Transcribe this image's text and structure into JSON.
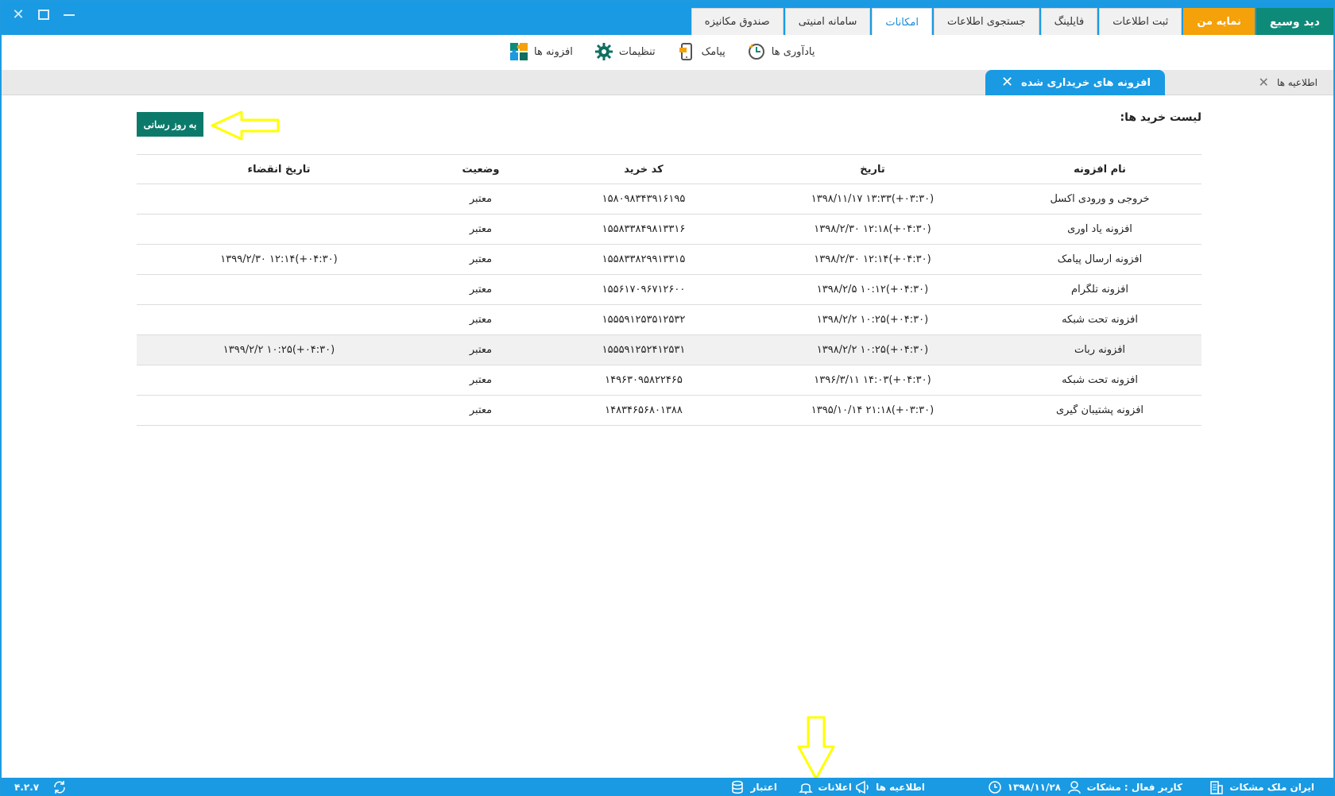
{
  "top_tabs": [
    {
      "label": "دید وسیع",
      "style": "teal"
    },
    {
      "label": "نمایه من",
      "style": "orange"
    },
    {
      "label": "ثبت اطلاعات",
      "style": "normal"
    },
    {
      "label": "فایلینگ",
      "style": "normal"
    },
    {
      "label": "جستجوی اطلاعات",
      "style": "normal"
    },
    {
      "label": "امکانات",
      "style": "active"
    },
    {
      "label": "سامانه امنیتی",
      "style": "normal"
    },
    {
      "label": "صندوق مکانیزه",
      "style": "normal"
    }
  ],
  "ribbon": {
    "reminders": "یادآوری ها",
    "sms": "پیامک",
    "settings": "تنظیمات",
    "addons": "افزونه ها"
  },
  "doc_tabs": {
    "notices": "اطلاعیه ها",
    "purchased": "افزونه های خریداری شده"
  },
  "content": {
    "list_title": "لیست خرید ها:",
    "refresh_label": "به روز رسانی"
  },
  "table": {
    "headers": {
      "name": "نام افزونه",
      "date": "تاریخ",
      "code": "کد خرید",
      "status": "وضعیت",
      "expiry": "تاریخ انقضاء"
    },
    "rows": [
      {
        "name": "خروجی و ورودی اکسل",
        "date": "۱۳۹۸/۱۱/۱۷ ۱۳:۳۳(+۰۳:۳۰)",
        "code": "۱۵۸۰۹۸۳۴۳۹۱۶۱۹۵",
        "status": "معتبر",
        "expiry": ""
      },
      {
        "name": "افزونه یاد آوری",
        "date": "۱۳۹۸/۲/۳۰ ۱۲:۱۸(+۰۴:۳۰)",
        "code": "۱۵۵۸۳۳۸۴۹۸۱۳۳۱۶",
        "status": "معتبر",
        "expiry": ""
      },
      {
        "name": "افزونه ارسال پیامک",
        "date": "۱۳۹۸/۲/۳۰ ۱۲:۱۴(+۰۴:۳۰)",
        "code": "۱۵۵۸۳۳۸۲۹۹۱۳۳۱۵",
        "status": "معتبر",
        "expiry": "۱۳۹۹/۲/۳۰ ۱۲:۱۴(+۰۴:۳۰)"
      },
      {
        "name": "افزونه تلگرام",
        "date": "۱۳۹۸/۲/۵ ۱۰:۱۲(+۰۴:۳۰)",
        "code": "۱۵۵۶۱۷۰۹۶۷۱۲۶۰۰",
        "status": "معتبر",
        "expiry": ""
      },
      {
        "name": "افزونه تحت شبکه",
        "date": "۱۳۹۸/۲/۲ ۱۰:۲۵(+۰۴:۳۰)",
        "code": "۱۵۵۵۹۱۲۵۳۵۱۲۵۳۲",
        "status": "معتبر",
        "expiry": ""
      },
      {
        "name": "افزونه ربات",
        "date": "۱۳۹۸/۲/۲ ۱۰:۲۵(+۰۴:۳۰)",
        "code": "۱۵۵۵۹۱۲۵۲۴۱۲۵۳۱",
        "status": "معتبر",
        "expiry": "۱۳۹۹/۲/۲ ۱۰:۲۵(+۰۴:۳۰)"
      },
      {
        "name": "افزونه تحت شبکه",
        "date": "۱۳۹۶/۳/۱۱ ۱۴:۰۳(+۰۴:۳۰)",
        "code": "۱۴۹۶۳۰۹۵۸۲۲۴۶۵",
        "status": "معتبر",
        "expiry": ""
      },
      {
        "name": "افزونه پشتیبان گیری",
        "date": "۱۳۹۵/۱۰/۱۴ ۲۱:۱۸(+۰۳:۳۰)",
        "code": "۱۴۸۳۴۶۵۶۸۰۱۳۸۸",
        "status": "معتبر",
        "expiry": ""
      }
    ]
  },
  "statusbar": {
    "company": "ایران ملک مشکات",
    "active_user": "کاربر فعال : مشکات",
    "date": "۱۳۹۸/۱۱/۲۸",
    "notices": "اطلاعیه ها",
    "notifications": "اعلانات",
    "credit": "اعتبار",
    "version": "۴.۲.۷"
  },
  "colors": {
    "primary": "#1a9ae2",
    "teal": "#0e8a79",
    "orange": "#f5a10a",
    "annotation_arrow": "#ffff00"
  }
}
